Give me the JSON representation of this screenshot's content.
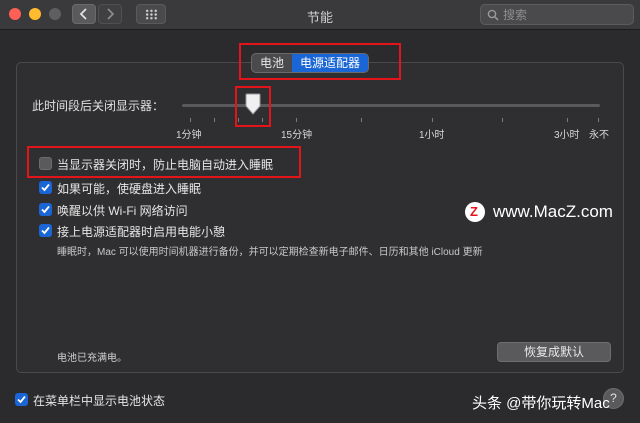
{
  "window": {
    "title": "节能"
  },
  "search": {
    "placeholder": "搜索"
  },
  "tabs": [
    {
      "label": "电池",
      "selected": false
    },
    {
      "label": "电源适配器",
      "selected": true
    }
  ],
  "display_sleep": {
    "label": "此时间段后关闭显示器：",
    "selected_value": "5分钟",
    "tick_labels": [
      "1分钟",
      "15分钟",
      "1小时",
      "3小时",
      "永不"
    ]
  },
  "options": [
    {
      "label": "当显示器关闭时，防止电脑自动进入睡眠",
      "checked": false
    },
    {
      "label": "如果可能，使硬盘进入睡眠",
      "checked": true
    },
    {
      "label": "唤醒以供 Wi-Fi 网络访问",
      "checked": true
    },
    {
      "label": "接上电源适配器时启用电能小憩",
      "checked": true
    }
  ],
  "power_nap_description": "睡眠时，Mac 可以使用时间机器进行备份，并可以定期检查新电子邮件、日历和其他 iCloud 更新",
  "battery_status": "电池已充满电。",
  "restore_defaults_label": "恢复成默认",
  "menubar_option": {
    "label": "在菜单栏中显示电池状态",
    "checked": true
  },
  "watermark_site": "www.MacZ.com",
  "watermark_logo_letter": "Z",
  "watermark_toutiao": "头条 @带你玩转Mac",
  "help_label": "?",
  "colors": {
    "accent": "#1a66d6",
    "highlight": "#e3151b"
  }
}
